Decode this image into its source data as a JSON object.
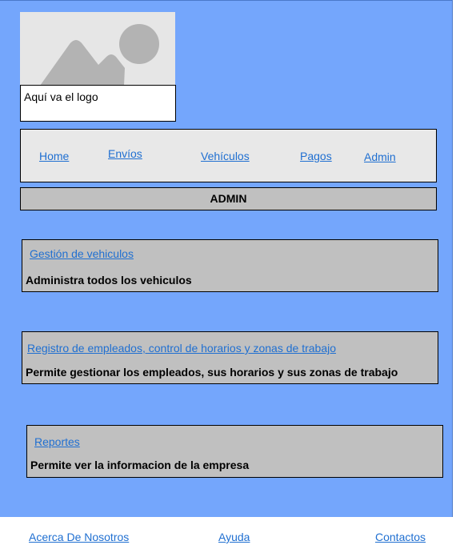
{
  "logo": {
    "caption": "Aquí va el logo",
    "image_icon": "image-placeholder-icon"
  },
  "nav": {
    "items": [
      {
        "label": "Home"
      },
      {
        "label": "Envíos"
      },
      {
        "label": "Vehículos"
      },
      {
        "label": "Pagos"
      },
      {
        "label": "Admin"
      }
    ]
  },
  "section_title": "ADMIN",
  "cards": [
    {
      "link": "Gestión de vehiculos",
      "description": "Administra todos los vehiculos"
    },
    {
      "link": "Registro de empleados, control de horarios y zonas de trabajo",
      "description": "Permite gestionar los empleados, sus horarios y sus zonas de trabajo"
    },
    {
      "link": "Reportes",
      "description": "Permite ver la informacion de la empresa"
    }
  ],
  "footer": {
    "links": [
      {
        "label": "Acerca De Nosotros"
      },
      {
        "label": "Ayuda"
      },
      {
        "label": "Contactos"
      }
    ]
  },
  "colors": {
    "page_background": "#74a6fc",
    "nav_background": "#e8e8e8",
    "card_background": "#c0c0c0",
    "link": "#1f6fd1"
  }
}
